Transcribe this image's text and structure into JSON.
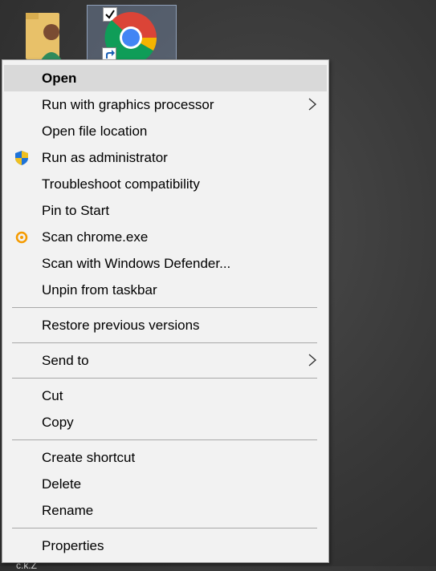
{
  "menu": {
    "items": [
      {
        "label": "Open"
      },
      {
        "label": "Run with graphics processor"
      },
      {
        "label": "Open file location"
      },
      {
        "label": "Run as administrator"
      },
      {
        "label": "Troubleshoot compatibility"
      },
      {
        "label": "Pin to Start"
      },
      {
        "label": "Scan chrome.exe"
      },
      {
        "label": "Scan with Windows Defender..."
      },
      {
        "label": "Unpin from taskbar"
      },
      {
        "label": "Restore previous versions"
      },
      {
        "label": "Send to"
      },
      {
        "label": "Cut"
      },
      {
        "label": "Copy"
      },
      {
        "label": "Create shortcut"
      },
      {
        "label": "Delete"
      },
      {
        "label": "Rename"
      },
      {
        "label": "Properties"
      }
    ]
  },
  "desktop": {
    "bottom_text": "ĉ.k.Z"
  },
  "icons": {
    "user_folder": "user-folder-icon",
    "chrome": "chrome-icon",
    "shield": "uac-shield-icon",
    "avast": "antivirus-icon",
    "submenu_arrow": "chevron-right-icon"
  },
  "colors": {
    "menu_bg": "#f2f2f2",
    "hover_bg": "#d9d9d9",
    "separator": "#a8a8a8"
  }
}
